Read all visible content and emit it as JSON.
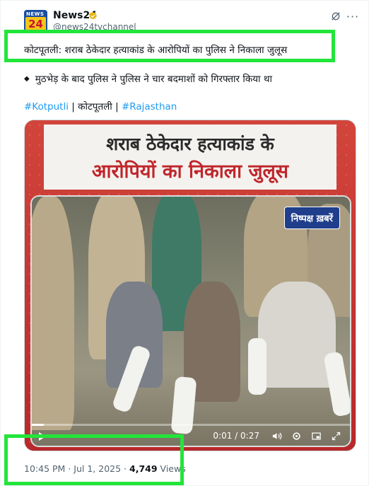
{
  "account": {
    "name": "News24",
    "handle": "@news24tvchannel",
    "avatar_text_top": "NEWS",
    "avatar_text_main": "24"
  },
  "post": {
    "headline": "कोटपूतली: शराब ठेकेदार हत्याकांड के आरोपियों का पुलिस ने निकाला जुलूस",
    "bullet_symbol": "◆",
    "bullet_text": "मुठभेड़ के बाद पुलिस ने पुलिस ने चार बदमाशों को गिरफ्तार किया था",
    "tags": [
      {
        "text": "#Kotputli",
        "type": "hashtag"
      },
      {
        "text": " | ",
        "type": "sep"
      },
      {
        "text": "कोटपूतली",
        "type": "plain"
      },
      {
        "text": " | ",
        "type": "sep"
      },
      {
        "text": "#Rajasthan",
        "type": "hashtag"
      }
    ]
  },
  "media": {
    "title_line1": "शराब ठेकेदार हत्याकांड के",
    "title_line2": "आरोपियों का निकाला जुलूस",
    "brand_label": "निष्पक्ष ख़बरें",
    "time_display": "0:01 / 0:27",
    "progress_fraction": 0.037,
    "icons": [
      "play-icon",
      "volume-icon",
      "settings-icon",
      "pip-icon",
      "fullscreen-icon"
    ]
  },
  "meta": {
    "time": "10:45 PM",
    "date": "Jul 1, 2025",
    "dot": "·",
    "views_count": "4,749",
    "views_label": "Views"
  },
  "colors": {
    "highlight": "#22e53a",
    "link": "#1d9bf0",
    "muted": "#536471",
    "verified": "#e2b719"
  }
}
